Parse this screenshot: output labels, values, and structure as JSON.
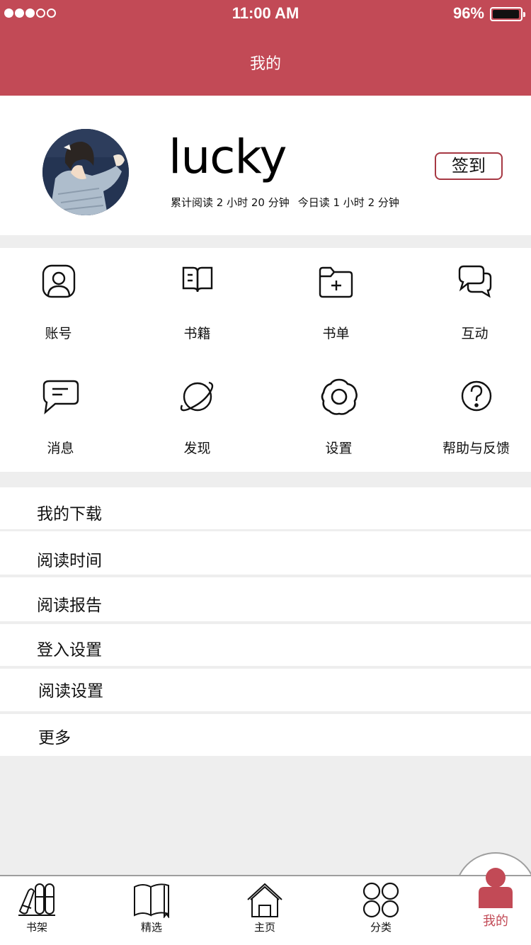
{
  "status_bar": {
    "time": "11:00 AM",
    "battery": "96%"
  },
  "header": {
    "title": "我的"
  },
  "profile": {
    "username": "lucky",
    "total_reading": "累计阅读 2 小时 20 分钟",
    "today_reading": "今日读 1 小时 2 分钟",
    "checkin_label": "签到"
  },
  "grid": [
    {
      "label": "账号",
      "icon": "account-icon"
    },
    {
      "label": "书籍",
      "icon": "book-icon"
    },
    {
      "label": "书单",
      "icon": "folder-add-icon"
    },
    {
      "label": "互动",
      "icon": "chat-bubbles-icon"
    },
    {
      "label": "消息",
      "icon": "message-icon"
    },
    {
      "label": "发现",
      "icon": "planet-icon"
    },
    {
      "label": "设置",
      "icon": "settings-icon"
    },
    {
      "label": "帮助与反馈",
      "icon": "help-icon"
    }
  ],
  "menu": [
    {
      "label": "我的下载"
    },
    {
      "label": "阅读时间"
    },
    {
      "label": "阅读报告"
    },
    {
      "label": "登入设置"
    },
    {
      "label": "阅读设置"
    },
    {
      "label": "更多"
    }
  ],
  "tabs": [
    {
      "label": "书架",
      "icon": "bookshelf-icon"
    },
    {
      "label": "精选",
      "icon": "open-book-icon"
    },
    {
      "label": "主页",
      "icon": "home-icon"
    },
    {
      "label": "分类",
      "icon": "categories-icon"
    },
    {
      "label": "我的",
      "icon": "person-icon",
      "active": true
    }
  ],
  "colors": {
    "accent": "#c24a56",
    "background": "#eeeeee"
  }
}
